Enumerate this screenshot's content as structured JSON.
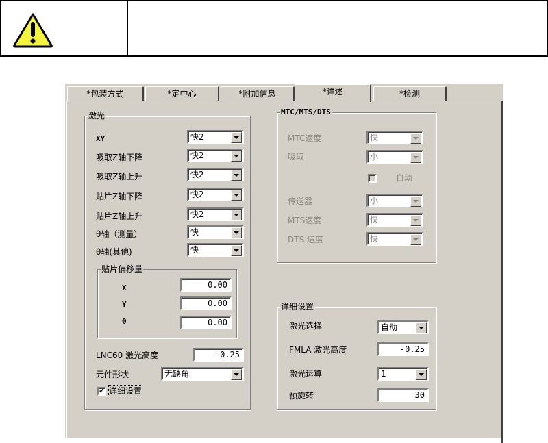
{
  "warning": {
    "icon": "warning-icon"
  },
  "tabs": [
    "*包装方式",
    "*定中心",
    "*附加信息",
    "*详述",
    "*检测"
  ],
  "laser": {
    "title": "激光",
    "rows": [
      {
        "label": "XY",
        "value": "快2"
      },
      {
        "label": "吸取Z轴下降",
        "value": "快2"
      },
      {
        "label": "吸取Z轴上升",
        "value": "快2"
      },
      {
        "label": "贴片Z轴下降",
        "value": "快2"
      },
      {
        "label": "贴片Z轴上升",
        "value": "快2"
      },
      {
        "label": "θ轴（测量）",
        "value": "快"
      },
      {
        "label": "θ轴(其他)",
        "value": "快"
      }
    ],
    "offset": {
      "title": "贴片偏移量",
      "rows": [
        {
          "label": "X",
          "value": "0.00"
        },
        {
          "label": "Y",
          "value": "0.00"
        },
        {
          "label": "θ",
          "value": "0.00"
        }
      ]
    },
    "lnc60_label": "LNC60 激光高度",
    "lnc60_value": "-0.25",
    "shape_label": "元件形状",
    "shape_value": "无缺角",
    "detail_check_label": "详细设置",
    "detail_checked": true
  },
  "mtc": {
    "title": "MTC/MTS/DTS",
    "mtc_speed_label": "MTC速度",
    "mtc_speed": "快",
    "pickup_label": "吸取",
    "pickup": "小",
    "auto_label": "自动",
    "conveyor_label": "传送器",
    "conveyor": "小",
    "mts_label": "MTS速度",
    "mts": "快",
    "dts_label": "DTS 速度",
    "dts": "快"
  },
  "detail": {
    "title": "详细设置",
    "laser_select_label": "激光选择",
    "laser_select": "自动",
    "fmla_label": "FMLA 激光高度",
    "fmla_value": "-0.25",
    "calc_label": "激光运算",
    "calc_value": "1",
    "prerotate_label": "预旋转",
    "prerotate_value": "30"
  }
}
